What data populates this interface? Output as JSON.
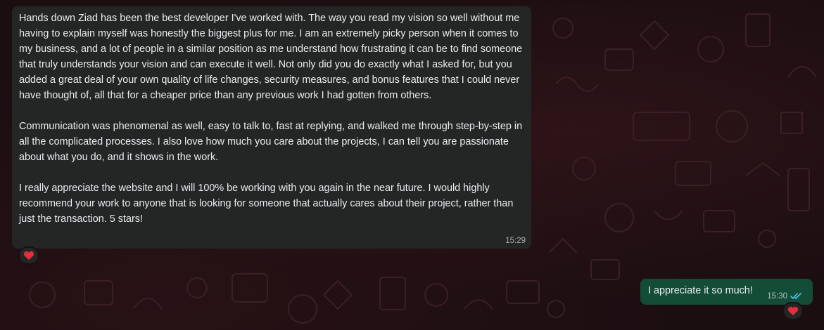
{
  "chat": {
    "incoming": {
      "paragraphs": [
        "Hands down Ziad has been the best developer I've worked with. The way you read my vision so well without me having to explain myself was honestly the biggest plus for me. I am an extremely picky person when it comes to my business, and a lot of people in a similar position as me understand how frustrating it can be to find someone that truly understands your vision and can execute it well. Not only did you do exactly what I asked for, but you added a great deal of your own quality of life changes, security measures, and bonus features that I could never have thought of, all that for a cheaper price than any previous work I had gotten from others.",
        "Communication was phenomenal as well, easy to talk to, fast at replying, and walked me through step-by-step in all the complicated processes. I also love how much you care about the projects, I can tell you are passionate about what you do, and it shows in the work.",
        "I really appreciate the website and I will 100% be working with you again in the near future. I would highly recommend your work to anyone that is looking for someone that actually cares about their project, rather than just the transaction. 5 stars!"
      ],
      "time": "15:29",
      "reaction": "❤️"
    },
    "outgoing": {
      "text": "I appreciate it so much!",
      "time": "15:30",
      "status_icon": "double-check-read-icon",
      "reaction": "❤️"
    },
    "colors": {
      "incoming_bubble": "#242626",
      "outgoing_bubble": "#144d37",
      "read_ticks": "#53bdeb",
      "text": "#e9edef"
    }
  }
}
